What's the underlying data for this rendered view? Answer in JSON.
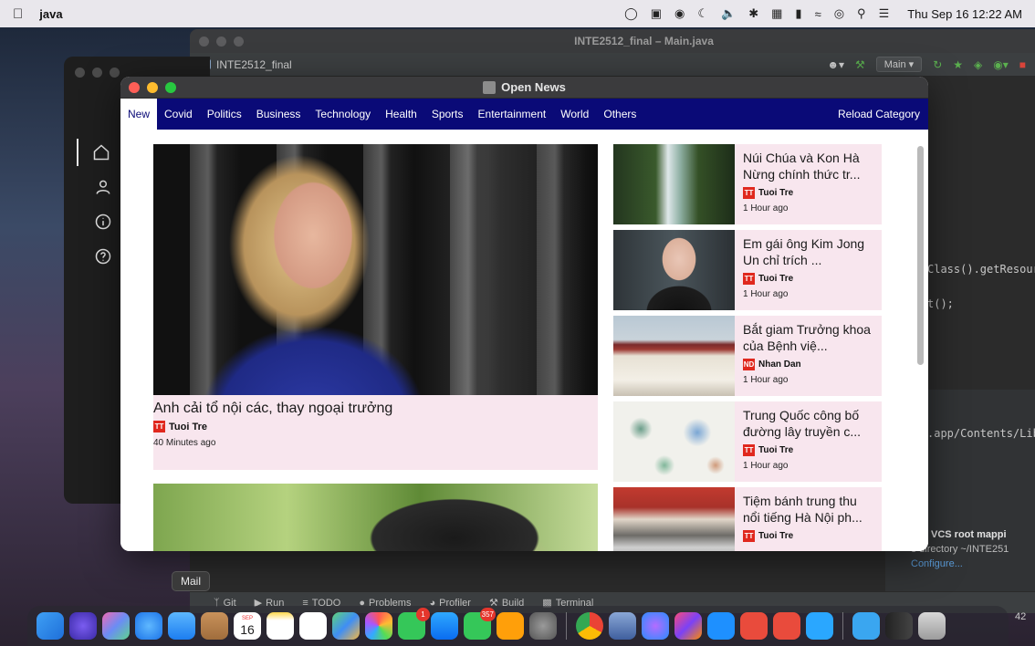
{
  "menubar": {
    "app_name": "java",
    "clock": "Thu Sep 16  12:22 AM"
  },
  "ide": {
    "title": "INTE2512_final – Main.java",
    "project": "INTE2512_final",
    "run_config": "Main",
    "code_lines": [
      "Class().getResour",
      "t();",
      ".app/Contents/Lib"
    ],
    "vcs_title": "alid VCS root mappi",
    "vcs_text": "e directory ~/INTE251",
    "vcs_link": "Configure...",
    "status_items": [
      "Git",
      "Run",
      "TODO",
      "Problems",
      "Profiler",
      "Build",
      "Terminal"
    ],
    "side_time": "42"
  },
  "news": {
    "window_title": "Open News",
    "categories": [
      "New",
      "Covid",
      "Politics",
      "Business",
      "Technology",
      "Health",
      "Sports",
      "Entertainment",
      "World",
      "Others"
    ],
    "active_category": "New",
    "reload_label": "Reload Category",
    "feature": {
      "title": "Anh cải tổ nội các, thay ngoại trưởng",
      "source": "Tuoi Tre",
      "time": "40 Minutes ago"
    },
    "articles": [
      {
        "title": "Núi Chúa và Kon Hà Nừng chính thức tr...",
        "source": "Tuoi Tre",
        "time": "1 Hour ago"
      },
      {
        "title": "Em gái ông Kim Jong Un chỉ trích ...",
        "source": "Tuoi Tre",
        "time": "1 Hour ago"
      },
      {
        "title": "Bắt giam Trưởng khoa của Bệnh việ...",
        "source": "Nhan Dan",
        "time": "1 Hour ago"
      },
      {
        "title": "Trung Quốc công bố đường lây truyền c...",
        "source": "Tuoi Tre",
        "time": "1 Hour ago"
      },
      {
        "title": "Tiệm bánh trung thu nổi tiếng Hà Nội ph...",
        "source": "Tuoi Tre",
        "time": ""
      }
    ]
  },
  "tooltip": "Mail",
  "dock": {
    "calendar_month": "SEP",
    "calendar_day": "16",
    "facetime_badge": "1",
    "messages_badge": "357"
  }
}
